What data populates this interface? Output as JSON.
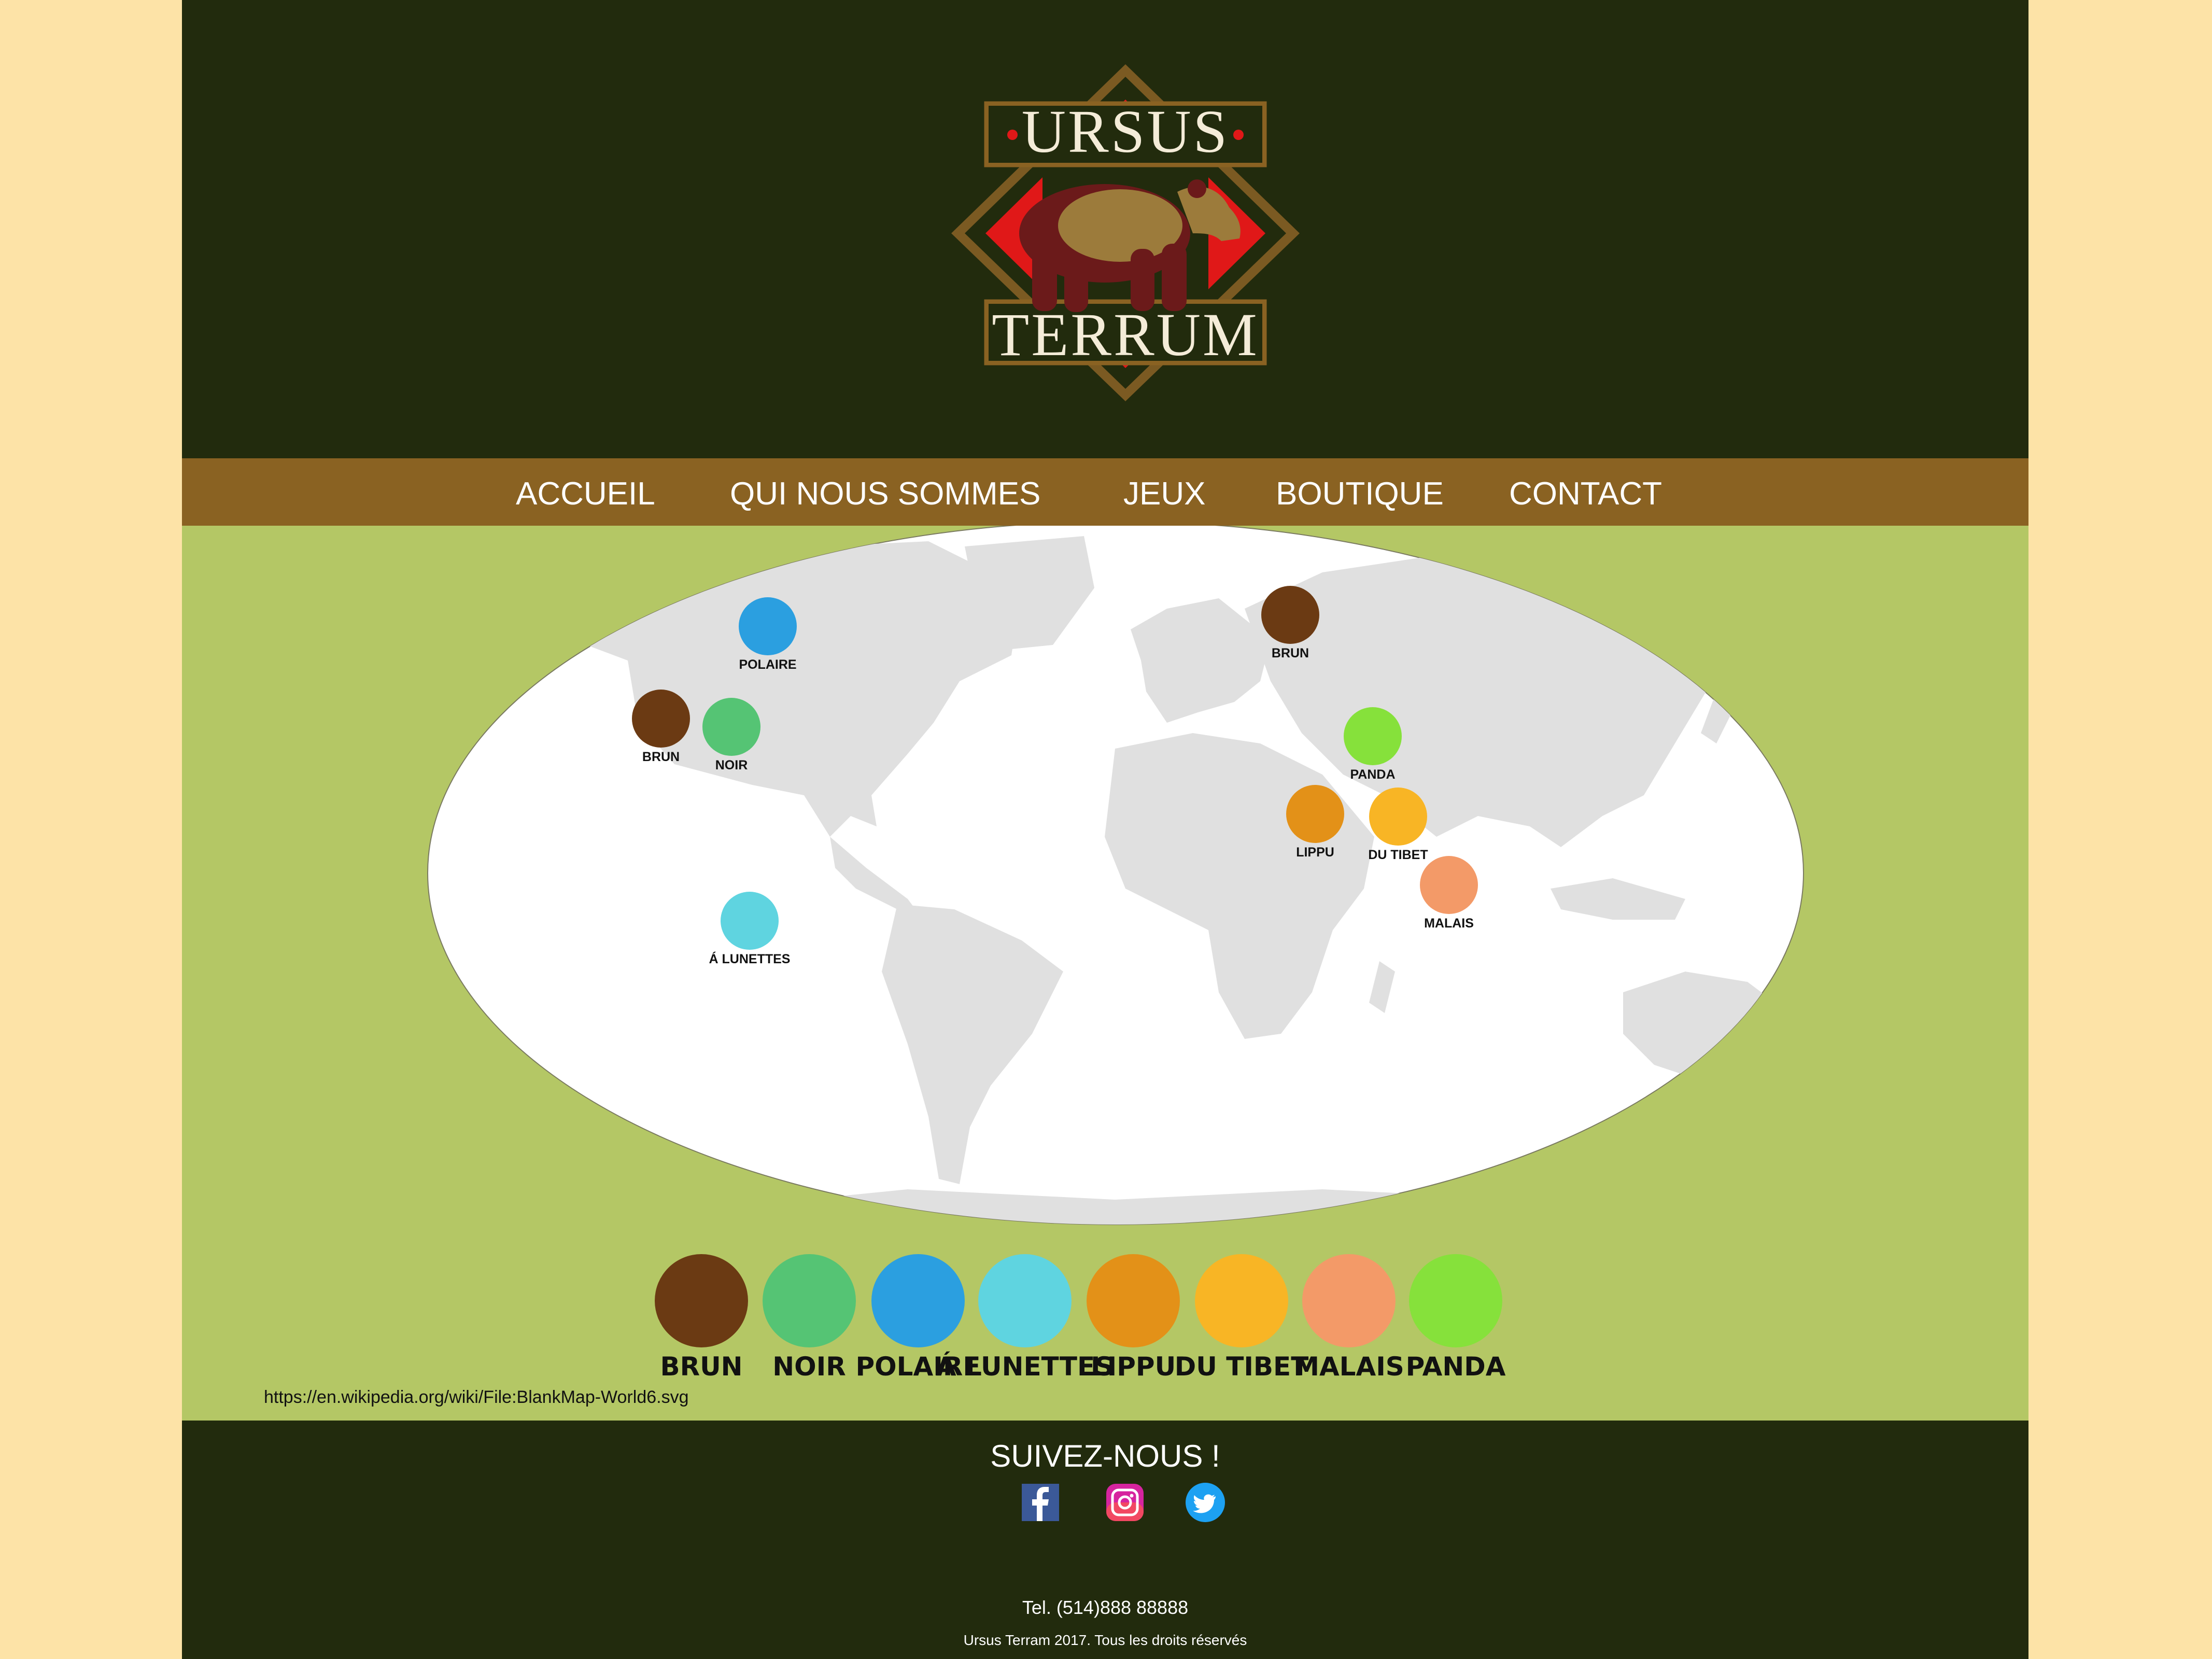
{
  "logo": {
    "title_top": "URSUS",
    "title_bottom": "TERRUM"
  },
  "nav": {
    "items": [
      {
        "label": "ACCUEIL"
      },
      {
        "label": "QUI NOUS SOMMES"
      },
      {
        "label": "JEUX"
      },
      {
        "label": "BOUTIQUE"
      },
      {
        "label": "CONTACT"
      }
    ]
  },
  "map": {
    "pins": [
      {
        "label": "POLAIRE",
        "bear": "polaire"
      },
      {
        "label": "BRUN",
        "bear": "brun"
      },
      {
        "label": "NOIR",
        "bear": "noir"
      },
      {
        "label": "Á LUNETTES",
        "bear": "lunettes"
      },
      {
        "label": "BRUN",
        "bear": "brun"
      },
      {
        "label": "PANDA",
        "bear": "panda"
      },
      {
        "label": "LIPPU",
        "bear": "lippu"
      },
      {
        "label": "DU TIBET",
        "bear": "tibet"
      },
      {
        "label": "MALAIS",
        "bear": "malais"
      }
    ],
    "source": "https://en.wikipedia.org/wiki/File:BlankMap-World6.svg"
  },
  "legend": {
    "items": [
      {
        "label": "BRUN",
        "bear": "brun"
      },
      {
        "label": "NOIR",
        "bear": "noir"
      },
      {
        "label": "POLAIRE",
        "bear": "polaire"
      },
      {
        "label": "Á LUNETTES",
        "bear": "lunettes"
      },
      {
        "label": "LIPPU",
        "bear": "lippu"
      },
      {
        "label": "DU TIBET",
        "bear": "tibet"
      },
      {
        "label": "MALAIS",
        "bear": "malais"
      },
      {
        "label": "PANDA",
        "bear": "panda"
      }
    ]
  },
  "bear_colors": {
    "brun": "#6b3a13",
    "noir": "#55c474",
    "polaire": "#2b9fe0",
    "lunettes": "#5fd4e0",
    "lippu": "#e39118",
    "tibet": "#f8b525",
    "malais": "#f39a68",
    "panda": "#86e13b"
  },
  "footer": {
    "follow": "SUIVEZ-NOUS !",
    "social": [
      {
        "name": "facebook-icon",
        "color": "#3b5998"
      },
      {
        "name": "instagram-icon",
        "color": "#c13584"
      },
      {
        "name": "twitter-icon",
        "color": "#1da1f2"
      }
    ],
    "tel": "Tel. (514)888 88888",
    "copyright": "Ursus Terram 2017. Tous les droits réservés"
  },
  "colors": {
    "page_bg": "#fde3a7",
    "dark": "#222b0d",
    "nav": "#8a6222",
    "main": "#b4c765",
    "land": "#e0e0e0"
  }
}
